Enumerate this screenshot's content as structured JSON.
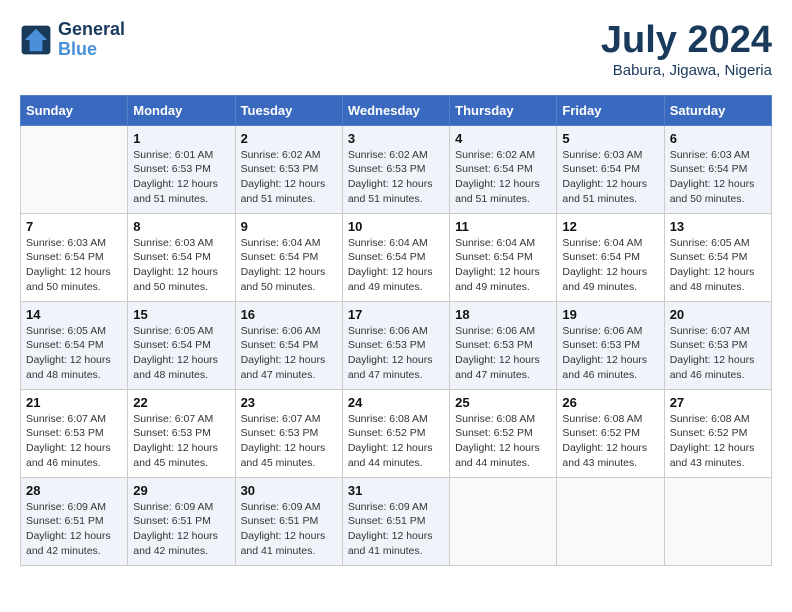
{
  "header": {
    "logo_line1": "General",
    "logo_line2": "Blue",
    "month_year": "July 2024",
    "location": "Babura, Jigawa, Nigeria"
  },
  "weekdays": [
    "Sunday",
    "Monday",
    "Tuesday",
    "Wednesday",
    "Thursday",
    "Friday",
    "Saturday"
  ],
  "weeks": [
    [
      {
        "day": "",
        "sunrise": "",
        "sunset": "",
        "daylight": ""
      },
      {
        "day": "1",
        "sunrise": "6:01 AM",
        "sunset": "6:53 PM",
        "daylight": "12 hours and 51 minutes."
      },
      {
        "day": "2",
        "sunrise": "6:02 AM",
        "sunset": "6:53 PM",
        "daylight": "12 hours and 51 minutes."
      },
      {
        "day": "3",
        "sunrise": "6:02 AM",
        "sunset": "6:53 PM",
        "daylight": "12 hours and 51 minutes."
      },
      {
        "day": "4",
        "sunrise": "6:02 AM",
        "sunset": "6:54 PM",
        "daylight": "12 hours and 51 minutes."
      },
      {
        "day": "5",
        "sunrise": "6:03 AM",
        "sunset": "6:54 PM",
        "daylight": "12 hours and 51 minutes."
      },
      {
        "day": "6",
        "sunrise": "6:03 AM",
        "sunset": "6:54 PM",
        "daylight": "12 hours and 50 minutes."
      }
    ],
    [
      {
        "day": "7",
        "sunrise": "6:03 AM",
        "sunset": "6:54 PM",
        "daylight": "12 hours and 50 minutes."
      },
      {
        "day": "8",
        "sunrise": "6:03 AM",
        "sunset": "6:54 PM",
        "daylight": "12 hours and 50 minutes."
      },
      {
        "day": "9",
        "sunrise": "6:04 AM",
        "sunset": "6:54 PM",
        "daylight": "12 hours and 50 minutes."
      },
      {
        "day": "10",
        "sunrise": "6:04 AM",
        "sunset": "6:54 PM",
        "daylight": "12 hours and 49 minutes."
      },
      {
        "day": "11",
        "sunrise": "6:04 AM",
        "sunset": "6:54 PM",
        "daylight": "12 hours and 49 minutes."
      },
      {
        "day": "12",
        "sunrise": "6:04 AM",
        "sunset": "6:54 PM",
        "daylight": "12 hours and 49 minutes."
      },
      {
        "day": "13",
        "sunrise": "6:05 AM",
        "sunset": "6:54 PM",
        "daylight": "12 hours and 48 minutes."
      }
    ],
    [
      {
        "day": "14",
        "sunrise": "6:05 AM",
        "sunset": "6:54 PM",
        "daylight": "12 hours and 48 minutes."
      },
      {
        "day": "15",
        "sunrise": "6:05 AM",
        "sunset": "6:54 PM",
        "daylight": "12 hours and 48 minutes."
      },
      {
        "day": "16",
        "sunrise": "6:06 AM",
        "sunset": "6:54 PM",
        "daylight": "12 hours and 47 minutes."
      },
      {
        "day": "17",
        "sunrise": "6:06 AM",
        "sunset": "6:53 PM",
        "daylight": "12 hours and 47 minutes."
      },
      {
        "day": "18",
        "sunrise": "6:06 AM",
        "sunset": "6:53 PM",
        "daylight": "12 hours and 47 minutes."
      },
      {
        "day": "19",
        "sunrise": "6:06 AM",
        "sunset": "6:53 PM",
        "daylight": "12 hours and 46 minutes."
      },
      {
        "day": "20",
        "sunrise": "6:07 AM",
        "sunset": "6:53 PM",
        "daylight": "12 hours and 46 minutes."
      }
    ],
    [
      {
        "day": "21",
        "sunrise": "6:07 AM",
        "sunset": "6:53 PM",
        "daylight": "12 hours and 46 minutes."
      },
      {
        "day": "22",
        "sunrise": "6:07 AM",
        "sunset": "6:53 PM",
        "daylight": "12 hours and 45 minutes."
      },
      {
        "day": "23",
        "sunrise": "6:07 AM",
        "sunset": "6:53 PM",
        "daylight": "12 hours and 45 minutes."
      },
      {
        "day": "24",
        "sunrise": "6:08 AM",
        "sunset": "6:52 PM",
        "daylight": "12 hours and 44 minutes."
      },
      {
        "day": "25",
        "sunrise": "6:08 AM",
        "sunset": "6:52 PM",
        "daylight": "12 hours and 44 minutes."
      },
      {
        "day": "26",
        "sunrise": "6:08 AM",
        "sunset": "6:52 PM",
        "daylight": "12 hours and 43 minutes."
      },
      {
        "day": "27",
        "sunrise": "6:08 AM",
        "sunset": "6:52 PM",
        "daylight": "12 hours and 43 minutes."
      }
    ],
    [
      {
        "day": "28",
        "sunrise": "6:09 AM",
        "sunset": "6:51 PM",
        "daylight": "12 hours and 42 minutes."
      },
      {
        "day": "29",
        "sunrise": "6:09 AM",
        "sunset": "6:51 PM",
        "daylight": "12 hours and 42 minutes."
      },
      {
        "day": "30",
        "sunrise": "6:09 AM",
        "sunset": "6:51 PM",
        "daylight": "12 hours and 41 minutes."
      },
      {
        "day": "31",
        "sunrise": "6:09 AM",
        "sunset": "6:51 PM",
        "daylight": "12 hours and 41 minutes."
      },
      {
        "day": "",
        "sunrise": "",
        "sunset": "",
        "daylight": ""
      },
      {
        "day": "",
        "sunrise": "",
        "sunset": "",
        "daylight": ""
      },
      {
        "day": "",
        "sunrise": "",
        "sunset": "",
        "daylight": ""
      }
    ]
  ]
}
